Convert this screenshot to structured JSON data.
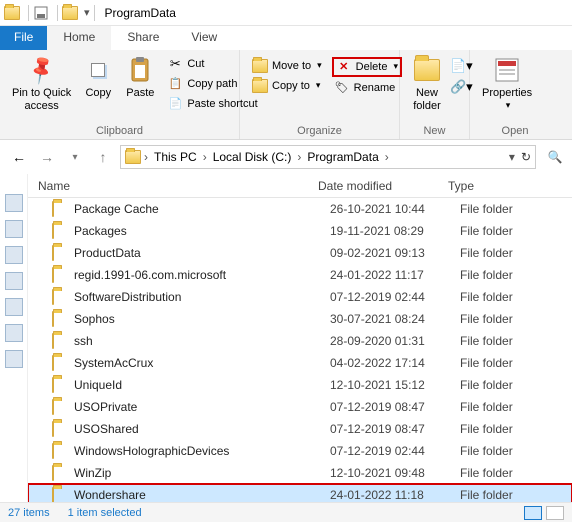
{
  "titlebar": {
    "title": "ProgramData"
  },
  "tabs": {
    "file": "File",
    "home": "Home",
    "share": "Share",
    "view": "View"
  },
  "ribbon": {
    "pin": "Pin to Quick\naccess",
    "copy": "Copy",
    "paste": "Paste",
    "cut": "Cut",
    "copypath": "Copy path",
    "pasteshortcut": "Paste shortcut",
    "clipboard": "Clipboard",
    "moveto": "Move to",
    "copyto": "Copy to",
    "delete": "Delete",
    "rename": "Rename",
    "organize": "Organize",
    "newfolder": "New\nfolder",
    "new": "New",
    "properties": "Properties",
    "open": "Open"
  },
  "addr": {
    "crumbs": [
      "This PC",
      "Local Disk (C:)",
      "ProgramData"
    ]
  },
  "columns": {
    "name": "Name",
    "date": "Date modified",
    "type": "Type"
  },
  "rows": [
    {
      "name": "Package Cache",
      "date": "26-10-2021 10:44",
      "type": "File folder"
    },
    {
      "name": "Packages",
      "date": "19-11-2021 08:29",
      "type": "File folder"
    },
    {
      "name": "ProductData",
      "date": "09-02-2021 09:13",
      "type": "File folder"
    },
    {
      "name": "regid.1991-06.com.microsoft",
      "date": "24-01-2022 11:17",
      "type": "File folder"
    },
    {
      "name": "SoftwareDistribution",
      "date": "07-12-2019 02:44",
      "type": "File folder"
    },
    {
      "name": "Sophos",
      "date": "30-07-2021 08:24",
      "type": "File folder"
    },
    {
      "name": "ssh",
      "date": "28-09-2020 01:31",
      "type": "File folder"
    },
    {
      "name": "SystemAcCrux",
      "date": "04-02-2022 17:14",
      "type": "File folder"
    },
    {
      "name": "UniqueId",
      "date": "12-10-2021 15:12",
      "type": "File folder"
    },
    {
      "name": "USOPrivate",
      "date": "07-12-2019 08:47",
      "type": "File folder"
    },
    {
      "name": "USOShared",
      "date": "07-12-2019 08:47",
      "type": "File folder"
    },
    {
      "name": "WindowsHolographicDevices",
      "date": "07-12-2019 02:44",
      "type": "File folder"
    },
    {
      "name": "WinZip",
      "date": "12-10-2021 09:48",
      "type": "File folder"
    },
    {
      "name": "Wondershare",
      "date": "24-01-2022 11:18",
      "type": "File folder",
      "selected": true
    }
  ],
  "status": {
    "count": "27 items",
    "sel": "1 item selected"
  }
}
